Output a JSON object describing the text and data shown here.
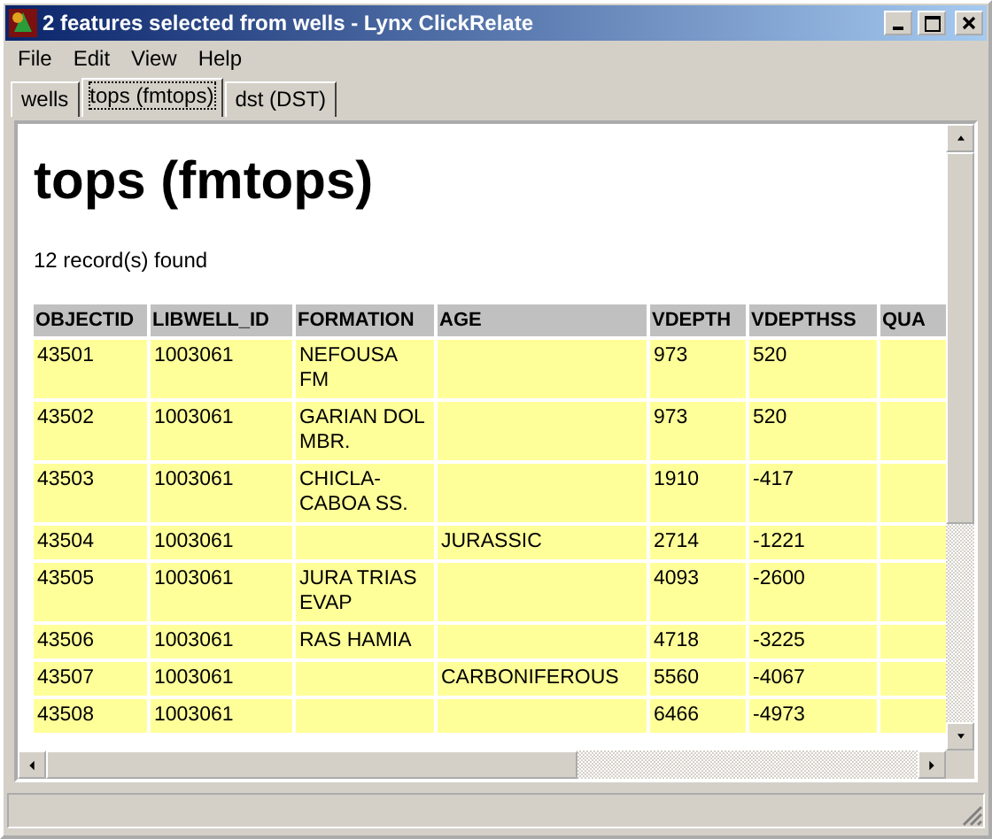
{
  "window": {
    "title": "2 features selected from wells - Lynx ClickRelate"
  },
  "menu": [
    {
      "label": "File"
    },
    {
      "label": "Edit"
    },
    {
      "label": "View"
    },
    {
      "label": "Help"
    }
  ],
  "tabs": [
    {
      "label": "wells",
      "selected": false
    },
    {
      "label": "tops (fmtops)",
      "selected": true
    },
    {
      "label": "dst (DST)",
      "selected": false
    }
  ],
  "page": {
    "heading": "tops (fmtops)",
    "count": "12 record(s) found"
  },
  "table": {
    "columns": [
      "OBJECTID",
      "LIBWELL_ID",
      "FORMATION",
      "AGE",
      "VDEPTH",
      "VDEPTHSS",
      "QUA"
    ],
    "rows": [
      [
        "43501",
        "1003061",
        "NEFOUSA FM",
        null,
        "973",
        "520",
        null
      ],
      [
        "43502",
        "1003061",
        "GARIAN DOL MBR.",
        null,
        "973",
        "520",
        null
      ],
      [
        "43503",
        "1003061",
        "CHICLA-CABOA SS.",
        null,
        "1910",
        "-417",
        null
      ],
      [
        "43504",
        "1003061",
        null,
        "JURASSIC",
        "2714",
        "-1221",
        null
      ],
      [
        "43505",
        "1003061",
        "JURA TRIAS EVAP",
        null,
        "4093",
        "-2600",
        null
      ],
      [
        "43506",
        "1003061",
        "RAS HAMIA",
        null,
        "4718",
        "-3225",
        null
      ],
      [
        "43507",
        "1003061",
        null,
        "CARBONIFEROUS",
        "5560",
        "-4067",
        null
      ],
      [
        "43508",
        "1003061",
        null,
        null,
        "6466",
        "-4973",
        null
      ]
    ]
  }
}
